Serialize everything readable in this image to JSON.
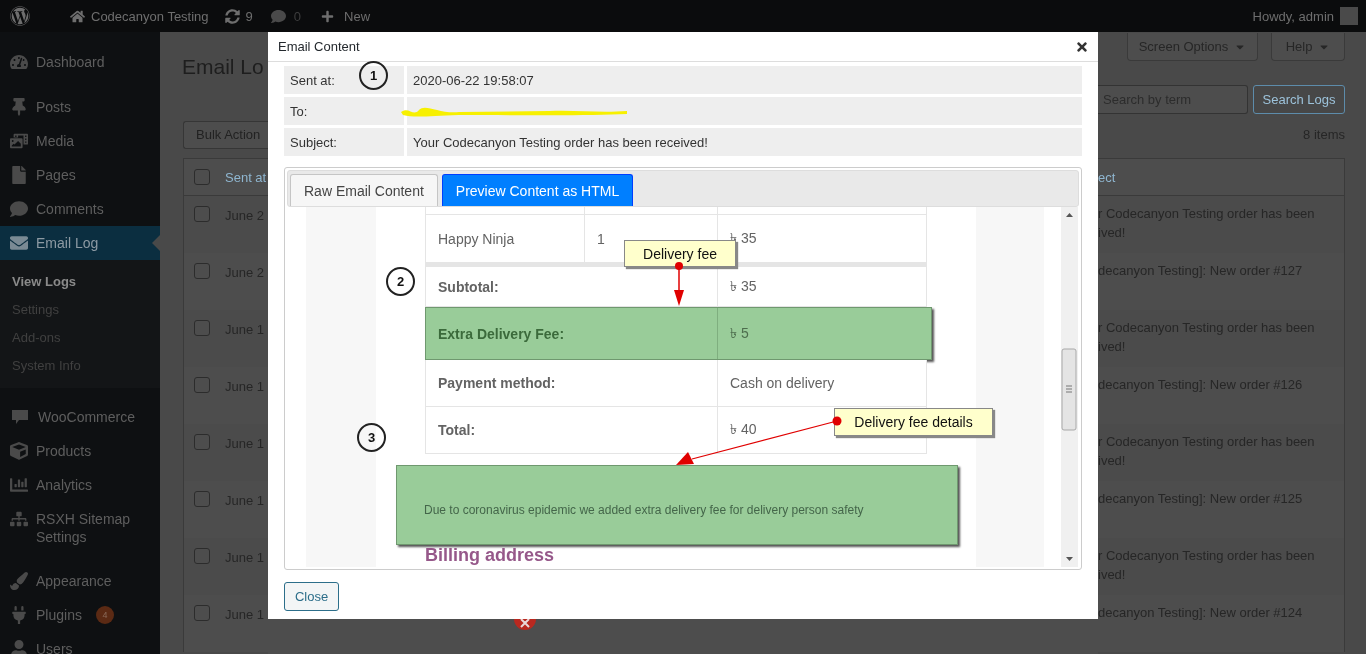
{
  "admin_bar": {
    "site": "Codecanyon Testing",
    "updates": "9",
    "comments": "0",
    "new": "New",
    "greeting": "Howdy, admin"
  },
  "sidebar": {
    "groups": [
      [
        {
          "kind": "dashboard",
          "label": "Dashboard",
          "selected": false
        }
      ],
      [
        {
          "kind": "posts",
          "label": "Posts",
          "selected": false
        },
        {
          "kind": "media",
          "label": "Media",
          "selected": false
        },
        {
          "kind": "pages",
          "label": "Pages",
          "selected": false
        },
        {
          "kind": "comments",
          "label": "Comments",
          "selected": false
        },
        {
          "kind": "email",
          "label": "Email Log",
          "selected": true,
          "children": [
            {
              "label": "View Logs",
              "selected": true
            },
            {
              "label": "Settings",
              "selected": false
            },
            {
              "label": "Add-ons",
              "selected": false
            },
            {
              "label": "System Info",
              "selected": false
            }
          ]
        }
      ],
      [
        {
          "kind": "woocommerce",
          "label": "WooCommerce",
          "selected": false
        },
        {
          "kind": "products",
          "label": "Products",
          "selected": false
        },
        {
          "kind": "analytics",
          "label": "Analytics",
          "selected": false
        },
        {
          "kind": "sitemap",
          "label": "RSXH Sitemap Settings",
          "selected": false
        }
      ],
      [
        {
          "kind": "appearance",
          "label": "Appearance",
          "selected": false
        },
        {
          "kind": "plugins",
          "label": "Plugins",
          "selected": false,
          "badge": "4"
        },
        {
          "kind": "users",
          "label": "Users",
          "selected": false
        }
      ]
    ]
  },
  "page": {
    "title": "Email Lo",
    "bulk_actions": "Bulk Action",
    "screen_options": "Screen Options",
    "help": "Help",
    "search": {
      "placeholder": "Search by term"
    },
    "search_button": "Search Logs",
    "count": "8 items",
    "table": {
      "left_header": "Sent at",
      "right_header": "ect",
      "select_all_checked": false,
      "rows": [
        {
          "checked": false,
          "date": "June 2",
          "subject": [
            "r Codecanyon Testing order has been",
            "ived!"
          ]
        },
        {
          "checked": false,
          "date": "June 2",
          "subject": [
            "decanyon Testing]: New order #127"
          ]
        },
        {
          "checked": false,
          "date": "June 1",
          "subject": [
            "r Codecanyon Testing order has been",
            "ived!"
          ]
        },
        {
          "checked": false,
          "date": "June 1",
          "subject": [
            "decanyon Testing]: New order #126"
          ]
        },
        {
          "checked": false,
          "date": "June 1",
          "subject": [
            "r Codecanyon Testing order has been",
            "ived!"
          ]
        },
        {
          "checked": false,
          "date": "June 1",
          "subject": [
            "decanyon Testing]: New order #125"
          ]
        },
        {
          "checked": false,
          "date": "June 1",
          "subject": [
            "r Codecanyon Testing order has been",
            "ived!"
          ]
        },
        {
          "checked": false,
          "date": "June 1",
          "subject": [
            "decanyon Testing]: New order #124"
          ]
        }
      ]
    }
  },
  "modal": {
    "title": "Email Content",
    "fields": [
      {
        "label": "Sent at:",
        "value": "2020-06-22 19:58:07"
      },
      {
        "label": "To:",
        "redacted": true
      },
      {
        "label": "Subject:",
        "value": "Your Codecanyon Testing order has been received!"
      }
    ],
    "tabs": [
      {
        "label": "Raw Email Content",
        "selected": false
      },
      {
        "label": "Preview Content as HTML",
        "selected": true
      }
    ],
    "preview": {
      "item_row": {
        "product": "Happy Ninja",
        "quantity": "1",
        "price": "৳ 35"
      },
      "totals": [
        {
          "label": "Subtotal:",
          "value": "৳ 35",
          "highlighted": false
        },
        {
          "label": "Extra Delivery Fee:",
          "value": "৳ 5",
          "highlighted": true
        },
        {
          "label": "Payment method:",
          "value": "Cash on delivery",
          "highlighted": false
        },
        {
          "label": "Total:",
          "value": "৳ 40",
          "highlighted": false
        }
      ],
      "note": "Due to coronavirus epidemic we added extra delivery fee for delivery person safety",
      "billing_heading": "Billing address"
    },
    "step_markers": [
      "1",
      "2",
      "3"
    ],
    "callouts": [
      "Delivery fee",
      "Delivery fee details"
    ],
    "close_button": "Close"
  }
}
